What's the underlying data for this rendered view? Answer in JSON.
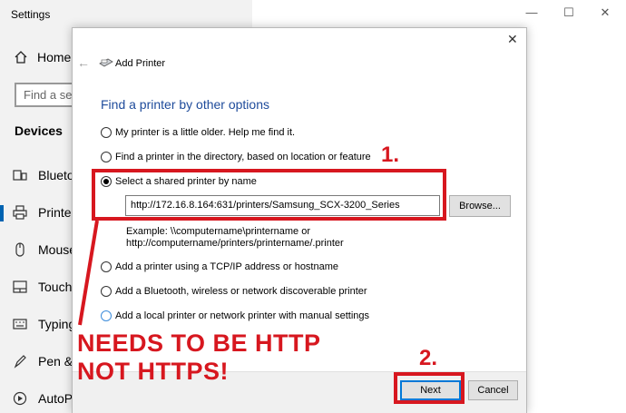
{
  "settings": {
    "title": "Settings",
    "home_label": "Home",
    "search_placeholder": "Find a setting",
    "section_heading": "Devices",
    "nav_items": [
      {
        "label": "Bluetooth & other devices",
        "icon": "bluetooth-device-icon"
      },
      {
        "label": "Printers & scanners",
        "icon": "printer-icon"
      },
      {
        "label": "Mouse",
        "icon": "mouse-icon"
      },
      {
        "label": "Touchpad",
        "icon": "touchpad-icon"
      },
      {
        "label": "Typing",
        "icon": "keyboard-icon"
      },
      {
        "label": "Pen & Windows Ink",
        "icon": "pen-icon"
      },
      {
        "label": "AutoPlay",
        "icon": "autoplay-icon"
      }
    ],
    "window_controls": {
      "minimize": "—",
      "maximize": "☐",
      "close": "✕"
    }
  },
  "dialog": {
    "title": "Add Printer",
    "heading": "Find a printer by other options",
    "options": [
      {
        "label": "My printer is a little older. Help me find it.",
        "checked": false
      },
      {
        "label": "Find a printer in the directory, based on location or feature",
        "checked": false
      },
      {
        "label": "Select a shared printer by name",
        "checked": true
      },
      {
        "label": "Add a printer using a TCP/IP address or hostname",
        "checked": false
      },
      {
        "label": "Add a Bluetooth, wireless or network discoverable printer",
        "checked": false
      },
      {
        "label": "Add a local printer or network printer with manual settings",
        "checked": false
      }
    ],
    "printer_url": "http://172.16.8.164:631/printers/Samsung_SCX-3200_Series",
    "browse_label": "Browse...",
    "example_line1": "Example: \\\\computername\\printername or",
    "example_line2": "http://computername/printers/printername/.printer",
    "next_label": "Next",
    "cancel_label": "Cancel",
    "close_glyph": "✕",
    "back_glyph": "←"
  },
  "annotations": {
    "step1": "1.",
    "step2": "2.",
    "note_line1": "NEEDS TO BE HTTP",
    "note_line2": "NOT HTTPS!",
    "color": "#d7171f"
  }
}
